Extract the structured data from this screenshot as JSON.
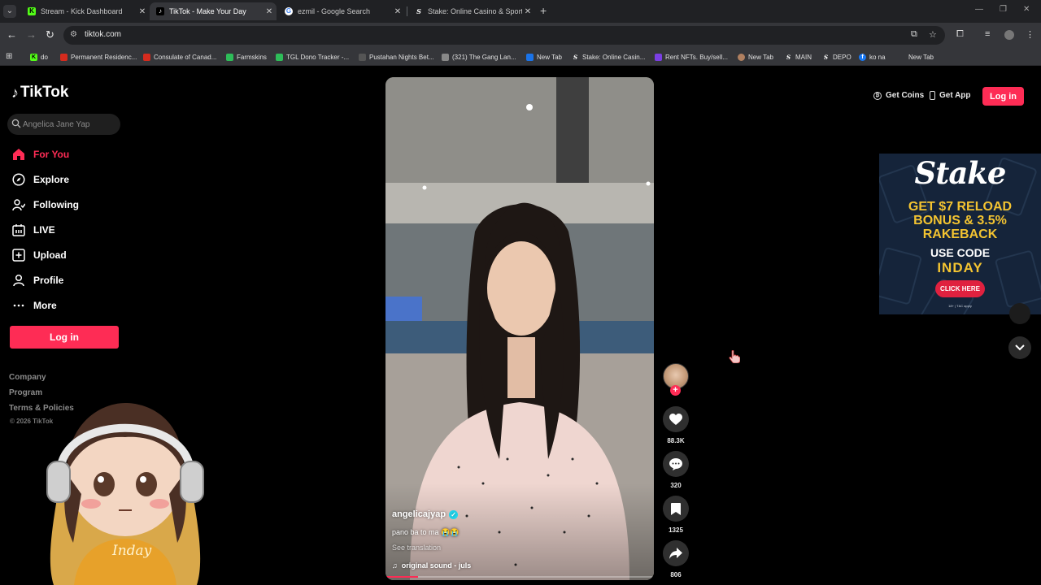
{
  "browser": {
    "tabs": [
      {
        "label": "Stream - Kick Dashboard",
        "active": false
      },
      {
        "label": "TikTok - Make Your Day",
        "active": true
      },
      {
        "label": "ezmil - Google Search",
        "active": false
      },
      {
        "label": "Stake: Online Casino & Sports B",
        "active": false
      }
    ],
    "url": "tiktok.com",
    "bookmarks": [
      "do",
      "Permanent Residenc...",
      "Consulate of Canad...",
      "Farmskins",
      "TGL Dono Tracker -...",
      "Pustahan Nights Bet...",
      "(321) The Gang Lan...",
      "New Tab",
      "Stake: Online Casin...",
      "Rent NFTs. Buy/sell...",
      "New Tab",
      "MAIN",
      "DEPO",
      "ko na",
      "New Tab"
    ]
  },
  "tiktok": {
    "logo": "TikTok",
    "search_placeholder": "Angelica Jane Yap",
    "nav": [
      {
        "label": "For You",
        "icon": "home-icon",
        "active": true
      },
      {
        "label": "Explore",
        "icon": "compass-icon",
        "active": false
      },
      {
        "label": "Following",
        "icon": "following-icon",
        "active": false
      },
      {
        "label": "LIVE",
        "icon": "live-icon",
        "active": false
      },
      {
        "label": "Upload",
        "icon": "upload-icon",
        "active": false
      },
      {
        "label": "Profile",
        "icon": "profile-icon",
        "active": false
      },
      {
        "label": "More",
        "icon": "more-icon",
        "active": false
      }
    ],
    "login_button": "Log in",
    "footer_links": [
      "Company",
      "Program",
      "Terms & Policies"
    ],
    "copyright": "© 2026 TikTok",
    "header": {
      "get_coins": "Get Coins",
      "get_app": "Get App",
      "login": "Log in"
    },
    "video": {
      "username": "angelicajyap",
      "caption": "pano ba to ma 😭😭",
      "see_translation": "See translation",
      "sound": "original sound - juls",
      "progress": 0.12
    },
    "actions": {
      "likes": "88.3K",
      "comments": "320",
      "bookmarks": "1325",
      "shares": "806"
    }
  },
  "overlay": {
    "streamer_label": "Inday"
  },
  "ad": {
    "brand": "Stake",
    "line1": "GET $7 RELOAD",
    "line2": "BONUS & 3.5%",
    "line3": "RAKEBACK",
    "line4": "USE CODE",
    "code": "INDAY",
    "cta": "CLICK HERE",
    "fine_print": "18+ | T&C apply"
  },
  "colors": {
    "accent": "#fe2c55",
    "ad_gold": "#f4c431",
    "verified": "#20d5ec"
  }
}
